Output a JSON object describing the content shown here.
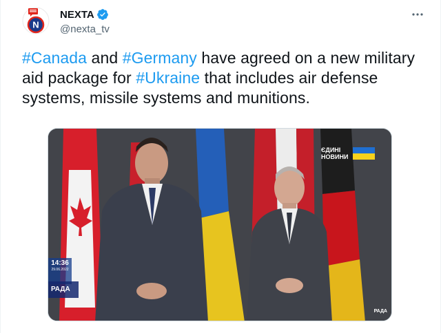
{
  "author": {
    "display_name": "NEXTA",
    "handle": "@nexta_tv",
    "verified": true,
    "avatar_icon": "nexta-logo-icon"
  },
  "menu_icon": "more-dots-icon",
  "tweet": {
    "segments": [
      {
        "text": "#Canada",
        "hashtag": true
      },
      {
        "text": " and ",
        "hashtag": false
      },
      {
        "text": "#Germany",
        "hashtag": true
      },
      {
        "text": " have agreed on a new military aid package for ",
        "hashtag": false
      },
      {
        "text": "#Ukraine",
        "hashtag": true
      },
      {
        "text": " that includes air defense systems, missile systems and munitions.",
        "hashtag": false
      }
    ]
  },
  "media": {
    "watermark_line1": "ЄДИНІ",
    "watermark_line2": "НОВИНИ",
    "clock_time": "14:36",
    "clock_date": "29.06.2022",
    "channel": "РАДА",
    "corner_logo": "РАДА"
  },
  "colors": {
    "link": "#1d9bf0",
    "verified": "#1d9bf0",
    "text": "#0f1419",
    "secondary": "#536471"
  }
}
